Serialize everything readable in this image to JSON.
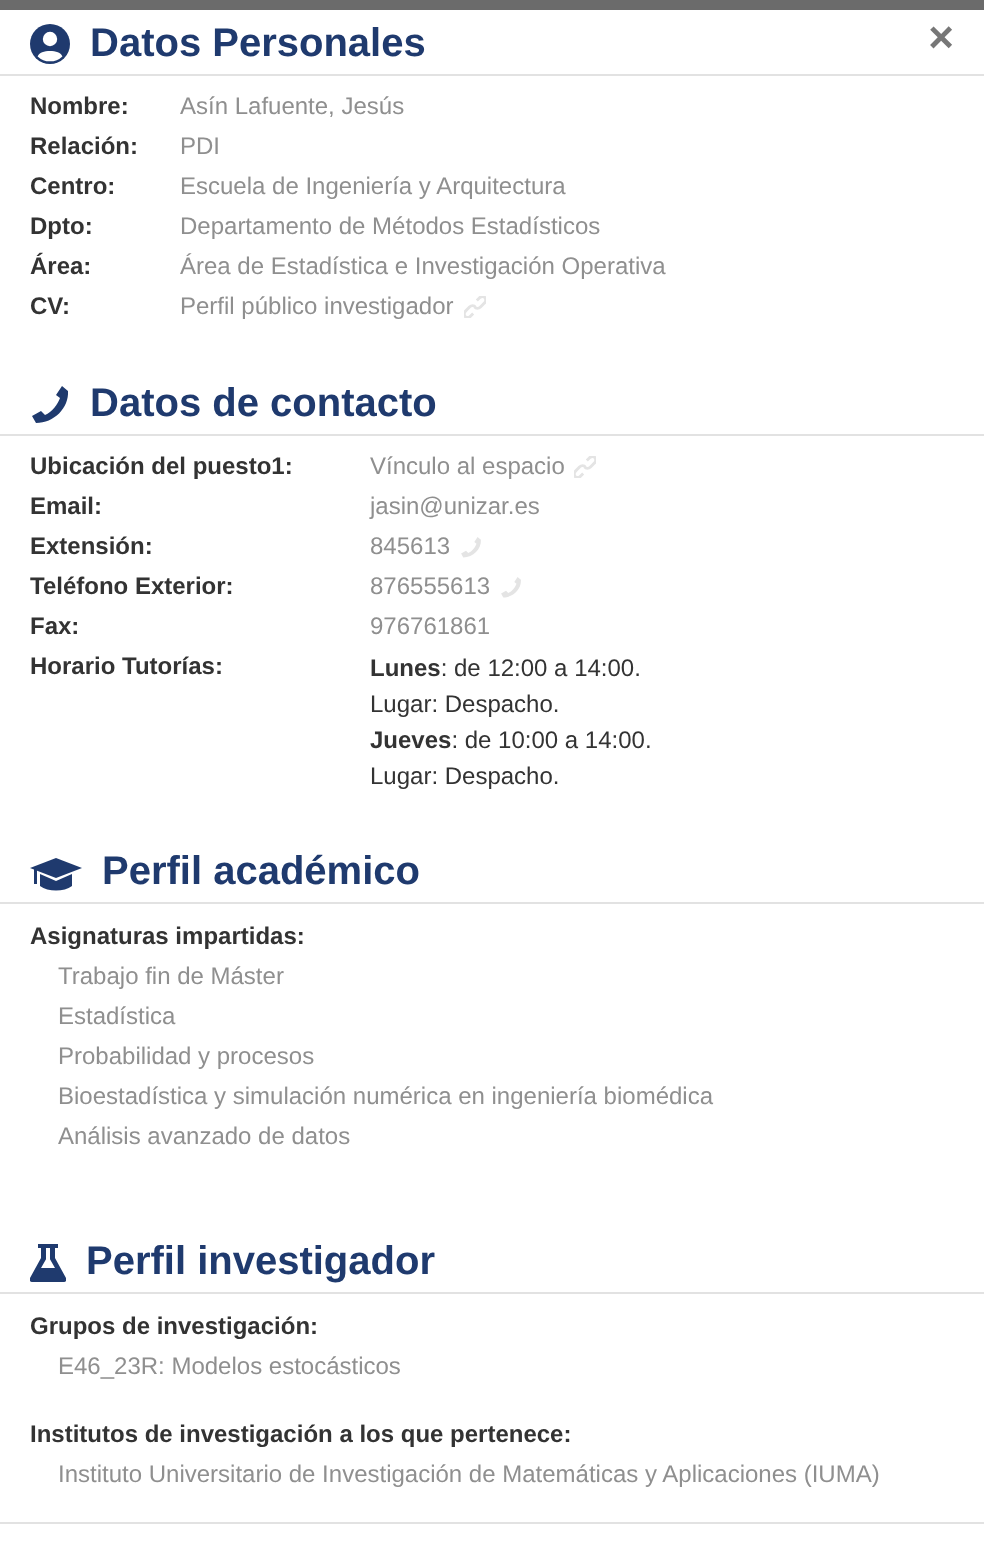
{
  "close": "×",
  "sections": [
    {
      "title": "Datos Personales",
      "kind": "fields",
      "fields": [
        {
          "label": "Nombre:",
          "kind": "text",
          "value": "Asín Lafuente, Jesús"
        },
        {
          "label": "Relación:",
          "kind": "text",
          "value": "PDI"
        },
        {
          "label": "Centro:",
          "kind": "text",
          "value": "Escuela de Ingeniería y Arquitectura"
        },
        {
          "label": "Dpto:",
          "kind": "text",
          "value": "Departamento de Métodos Estadísticos"
        },
        {
          "label": "Área:",
          "kind": "text",
          "value": "Área de Estadística e Investigación Operativa"
        },
        {
          "label": "CV:",
          "kind": "link",
          "value": "Perfil público investigador"
        }
      ]
    },
    {
      "title": "Datos de contacto",
      "kind": "fields",
      "fields": [
        {
          "label": "Ubicación del puesto1:",
          "kind": "link",
          "value": "Vínculo al espacio"
        },
        {
          "label": "Email:",
          "kind": "text",
          "value": "jasin@unizar.es"
        },
        {
          "label": "Extensión:",
          "kind": "phone",
          "value": "845613"
        },
        {
          "label": "Teléfono Exterior:",
          "kind": "phone",
          "value": "876555613"
        },
        {
          "label": "Fax:",
          "kind": "text",
          "value": "976761861"
        },
        {
          "label": "Horario Tutorías:",
          "kind": "schedule",
          "lines": [
            "**Lunes**: de 12:00 a 14:00.",
            "Lugar: Despacho.",
            "**Jueves**: de 10:00 a 14:00.",
            "Lugar: Despacho."
          ]
        }
      ]
    },
    {
      "title": "Perfil académico",
      "kind": "lists",
      "groups": [
        {
          "heading": "Asignaturas impartidas:",
          "items": [
            "Trabajo fin de Máster",
            "Estadística",
            "Probabilidad y procesos",
            "Bioestadística y simulación numérica en ingeniería biomédica",
            "Análisis avanzado de datos"
          ]
        }
      ]
    },
    {
      "title": "Perfil investigador",
      "kind": "lists",
      "groups": [
        {
          "heading": "Grupos de investigación:",
          "items": [
            "E46_23R: Modelos estocásticos"
          ]
        },
        {
          "heading": "Institutos de investigación a los que pertenece:",
          "items": [
            "Instituto Universitario de Investigación de Matemáticas y Aplicaciones (IUMA)"
          ]
        }
      ]
    }
  ]
}
